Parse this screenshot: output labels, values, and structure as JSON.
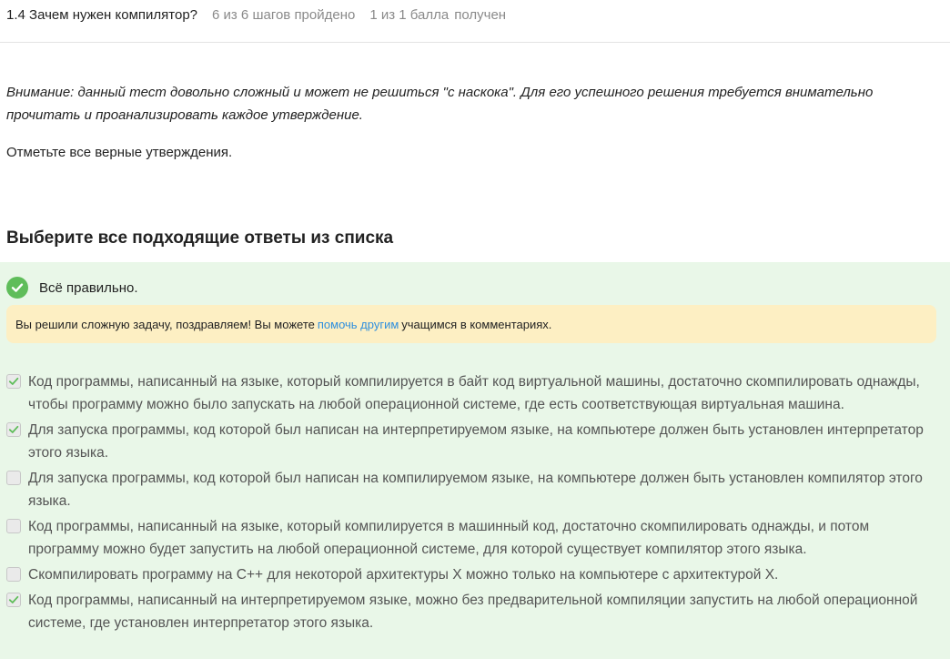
{
  "header": {
    "title": "1.4 Зачем нужен компилятор?",
    "progress": "6 из 6 шагов пройдено",
    "score": "1 из 1 балла",
    "score_suffix": "получен"
  },
  "intro": {
    "warning": "Внимание: данный тест довольно сложный и может не решиться \"с наскока\". Для его успешного решения требуется внимательно прочитать и проанализировать каждое утверждение.",
    "task": "Отметьте все верные утверждения."
  },
  "quiz": {
    "heading": "Выберите все подходящие ответы из списка",
    "status": "Всё правильно.",
    "hint": {
      "before": "Вы решили сложную задачу, поздравляем! Вы можете",
      "link": "помочь другим",
      "after": "учащимся в комментариях."
    },
    "options": [
      {
        "text": "Код программы, написанный на языке, который компилируется в байт код виртуальной машины, достаточно скомпилировать однажды, чтобы программу можно было запускать на любой операционной системе, где есть соответствующая виртуальная машина.",
        "checked": true
      },
      {
        "text": "Для запуска программы, код которой был написан на интерпретируемом языке, на компьютере должен быть установлен интерпретатор этого языка.",
        "checked": true
      },
      {
        "text": "Для запуска программы, код которой был написан на компилируемом языке, на компьютере должен быть установлен компилятор этого языка.",
        "checked": false
      },
      {
        "text": "Код программы, написанный на языке, который компилируется в машинный код, достаточно скомпилировать однажды, и потом программу можно будет запустить на любой операционной системе, для которой существует компилятор этого языка.",
        "checked": false
      },
      {
        "text": "Скомпилировать программу на C++ для некоторой архитектуры X можно только на компьютере с архитектурой X.",
        "checked": false
      },
      {
        "text": "Код программы, написанный на интерпретируемом языке, можно без предварительной компиляции запустить на любой операционной системе, где установлен интерпретатор этого языка.",
        "checked": true
      }
    ]
  },
  "icons": {
    "status": "check-circle-icon",
    "checkbox_checked": "checkmark-icon"
  },
  "colors": {
    "success": "#5fbd5a",
    "panel": "#e9f7e8",
    "hint_bg": "#fdefc3",
    "link": "#2f8fde"
  }
}
